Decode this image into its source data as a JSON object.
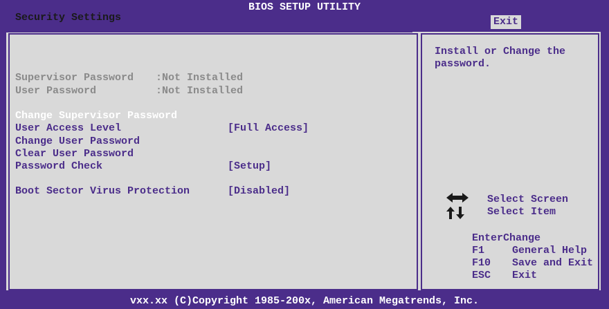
{
  "title": "BIOS SETUP UTILITY",
  "menu": {
    "active_tab": "Exit"
  },
  "section": {
    "title": "Security Settings"
  },
  "status": [
    {
      "label": "Supervisor Password",
      "value": ":Not Installed"
    },
    {
      "label": "User Password",
      "value": ":Not Installed"
    }
  ],
  "items": [
    {
      "label": "Change Supervisor Password",
      "value": ""
    },
    {
      "label": "User Access Level",
      "value": "[Full Access]"
    },
    {
      "label": "Change User Password",
      "value": ""
    },
    {
      "label": "Clear User Password",
      "value": ""
    },
    {
      "label": "Password Check",
      "value": "[Setup]"
    },
    {
      "label": "Boot Sector Virus Protection",
      "value": "[Disabled]"
    }
  ],
  "help": {
    "text": "Install or Change the password.",
    "keys": [
      {
        "key": "",
        "action": "Select Screen",
        "icon": "left-right-arrows-icon"
      },
      {
        "key": "",
        "action": "Select Item",
        "icon": "up-down-arrows-icon"
      },
      {
        "key": "Enter",
        "action": "Change"
      },
      {
        "key": "F1",
        "action": "General Help"
      },
      {
        "key": "F10",
        "action": "Save and Exit"
      },
      {
        "key": "ESC",
        "action": "Exit"
      }
    ]
  },
  "footer": "vxx.xx (C)Copyright 1985-200x, American Megatrends, Inc.",
  "colors": {
    "frame": "#4b2d8a",
    "panel": "#d9d9d9",
    "highlight": "#ffffff",
    "disabled": "#8a8a8a"
  }
}
